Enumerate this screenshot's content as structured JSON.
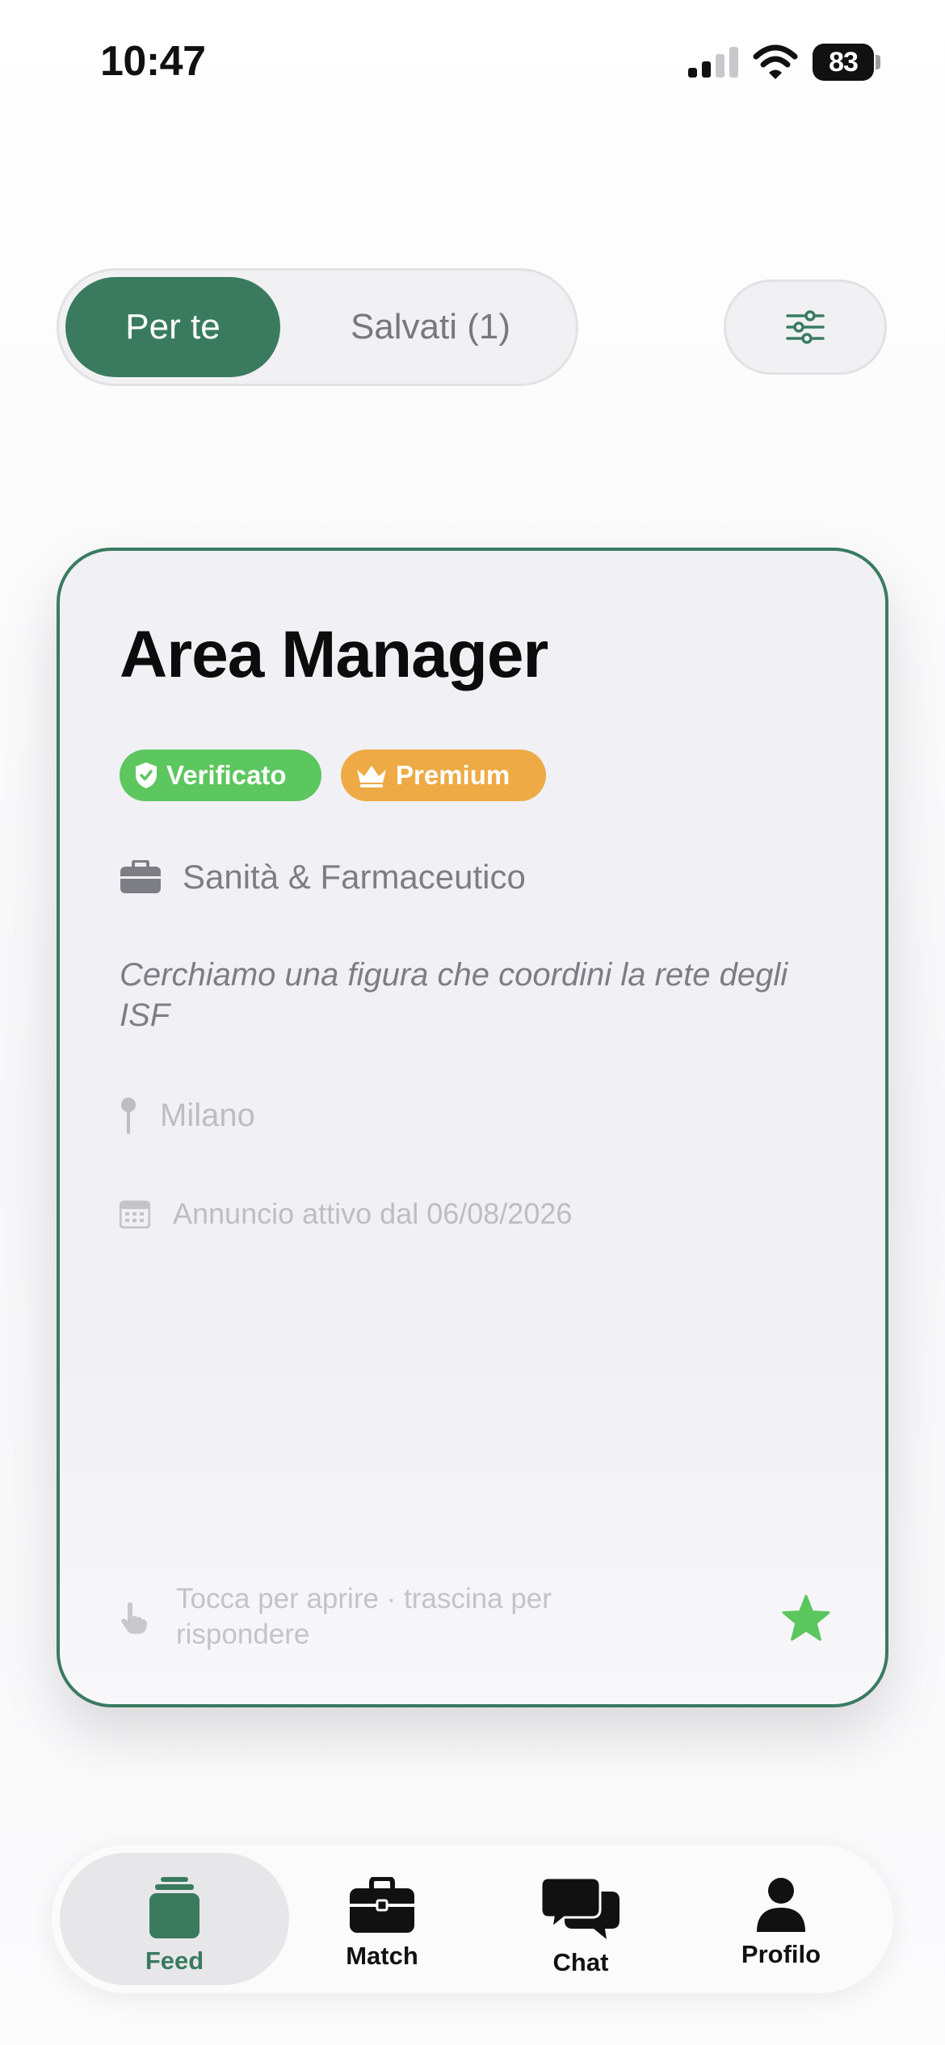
{
  "status_bar": {
    "time": "10:47",
    "battery": "83",
    "icons": [
      "signal-icon",
      "wifi-icon",
      "battery-icon"
    ]
  },
  "segmented": {
    "active_label": "Per te",
    "inactive_label": "Salvati (1)"
  },
  "filter": {
    "icon": "sliders-icon"
  },
  "card": {
    "title": "Area Manager",
    "badges": [
      {
        "label": "Verificato",
        "icon": "shield-check-icon",
        "color": "#5cc65f"
      },
      {
        "label": "Premium",
        "icon": "crown-icon",
        "color": "#eeaa45"
      }
    ],
    "sector": {
      "icon": "briefcase-icon",
      "label": "Sanità & Farmaceutico"
    },
    "description": "Cerchiamo una figura che coordini la rete degli ISF",
    "location": {
      "icon": "pin-icon",
      "label": "Milano"
    },
    "date": {
      "icon": "calendar-icon",
      "label": "Annuncio attivo dal 06/08/2026"
    },
    "hint": {
      "icon": "hand-pointer-icon",
      "label": "Tocca per aprire · trascina per rispondere"
    },
    "favorite": {
      "icon": "star-icon",
      "color": "#5cc65f"
    }
  },
  "tab_bar": {
    "tabs": [
      {
        "label": "Feed",
        "icon": "feed-stack-icon",
        "active": true
      },
      {
        "label": "Match",
        "icon": "briefcase-icon",
        "active": false
      },
      {
        "label": "Chat",
        "icon": "chat-bubbles-icon",
        "active": false
      },
      {
        "label": "Profilo",
        "icon": "person-icon",
        "active": false
      }
    ]
  },
  "colors": {
    "accent": "#3a7b60",
    "verified": "#5cc65f",
    "premium": "#eeaa45",
    "muted_text": "#7d7d85"
  }
}
